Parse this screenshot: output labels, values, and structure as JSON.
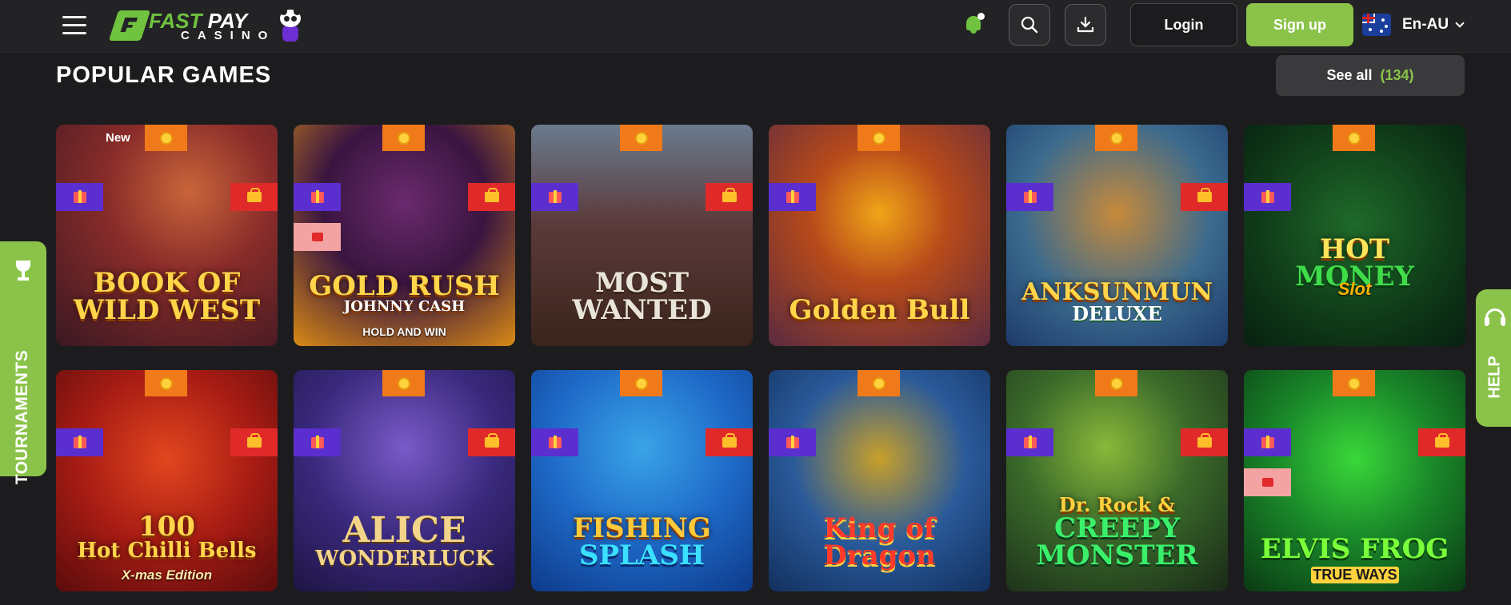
{
  "header": {
    "logo": {
      "line1_a": "FAST",
      "line1_b": " PAY",
      "line2": "CASINO"
    },
    "login_label": "Login",
    "signup_label": "Sign up",
    "language": "En-AU",
    "accent_color": "#8bc34a"
  },
  "section": {
    "title": "POPULAR GAMES",
    "see_all_label": "See all",
    "see_all_count": "(134)"
  },
  "games": [
    {
      "title_line1": "BOOK OF",
      "title_line2": "WILD WEST",
      "subtitle": "",
      "new_label": "New"
    },
    {
      "title_line1": "GOLD RUSH",
      "title_line2": "JOHNNY CASH",
      "subtitle": "HOLD AND WIN"
    },
    {
      "title_line1": "MOST",
      "title_line2": "WANTED",
      "subtitle": ""
    },
    {
      "title_line1": "Golden Bull",
      "title_line2": "",
      "subtitle": ""
    },
    {
      "title_line1": "ANKSUNMUN",
      "title_line2": "DELUXE",
      "subtitle": ""
    },
    {
      "title_line1": "HOT",
      "title_line2": "MONEY",
      "subtitle": "Slot"
    },
    {
      "title_line1": "100",
      "title_line2": "Hot Chilli Bells",
      "subtitle": "X-mas Edition"
    },
    {
      "title_line1": "ALICE",
      "title_line2": "WONDERLUCK",
      "subtitle": ""
    },
    {
      "title_line1": "FISHING",
      "title_line2": "SPLASH",
      "subtitle": ""
    },
    {
      "title_line1": "King of",
      "title_line2": "Dragon",
      "subtitle": ""
    },
    {
      "title_line1": "Dr. Rock &",
      "title_line2": "CREEPY MONSTER",
      "subtitle": ""
    },
    {
      "title_line1": "ELVIS FROG",
      "title_line2": "",
      "subtitle": "TRUE WAYS"
    }
  ],
  "side_tabs": {
    "tournaments_label": "TOURNAMENTS",
    "help_label": "HELP"
  }
}
